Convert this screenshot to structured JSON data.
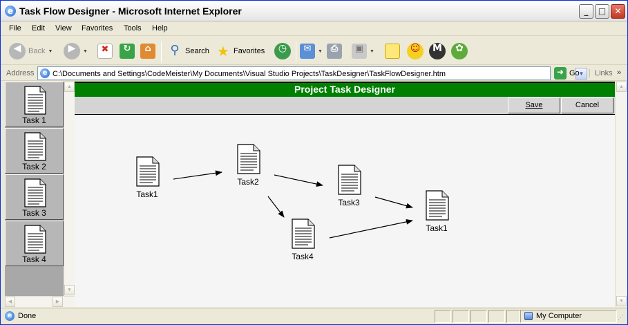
{
  "window": {
    "title": "Task Flow Designer - Microsoft Internet Explorer",
    "app_icon": "ie-icon",
    "caption_buttons": [
      "minimize",
      "maximize",
      "close"
    ]
  },
  "menu": {
    "items": [
      "File",
      "Edit",
      "View",
      "Favorites",
      "Tools",
      "Help"
    ]
  },
  "toolbar": {
    "back_label": "Back",
    "search_label": "Search",
    "favorites_label": "Favorites",
    "icons": [
      "back-icon",
      "forward-icon",
      "stop-icon",
      "refresh-icon",
      "home-icon",
      "search-icon",
      "favorites-star-icon",
      "history-icon",
      "mail-icon",
      "print-icon",
      "edit-icon",
      "notes-icon",
      "messenger-icon",
      "media-icon",
      "msn-icon"
    ]
  },
  "address": {
    "label": "Address",
    "url": "C:\\Documents and Settings\\CodeMeister\\My Documents\\Visual Studio Projects\\TaskDesigner\\TaskFlowDesigner.htm",
    "go_label": "Go",
    "links_label": "Links"
  },
  "palette": {
    "items": [
      {
        "label": "Task 1"
      },
      {
        "label": "Task 2"
      },
      {
        "label": "Task 3"
      },
      {
        "label": "Task 4"
      }
    ]
  },
  "designer": {
    "title": "Project Task Designer",
    "save_label": "Save",
    "cancel_label": "Cancel",
    "nodes": [
      {
        "id": "n1",
        "label": "Task1"
      },
      {
        "id": "n2",
        "label": "Task2"
      },
      {
        "id": "n3",
        "label": "Task3"
      },
      {
        "id": "n4",
        "label": "Task4"
      },
      {
        "id": "n5",
        "label": "Task1"
      }
    ],
    "edges": [
      {
        "from": "n1",
        "to": "n2"
      },
      {
        "from": "n2",
        "to": "n3"
      },
      {
        "from": "n2",
        "to": "n4"
      },
      {
        "from": "n3",
        "to": "n5"
      },
      {
        "from": "n4",
        "to": "n5"
      }
    ]
  },
  "status": {
    "text": "Done",
    "zone": "My Computer"
  },
  "colors": {
    "designer_header": "#008000",
    "window_border": "#0831d9",
    "chrome": "#ece9d8"
  }
}
